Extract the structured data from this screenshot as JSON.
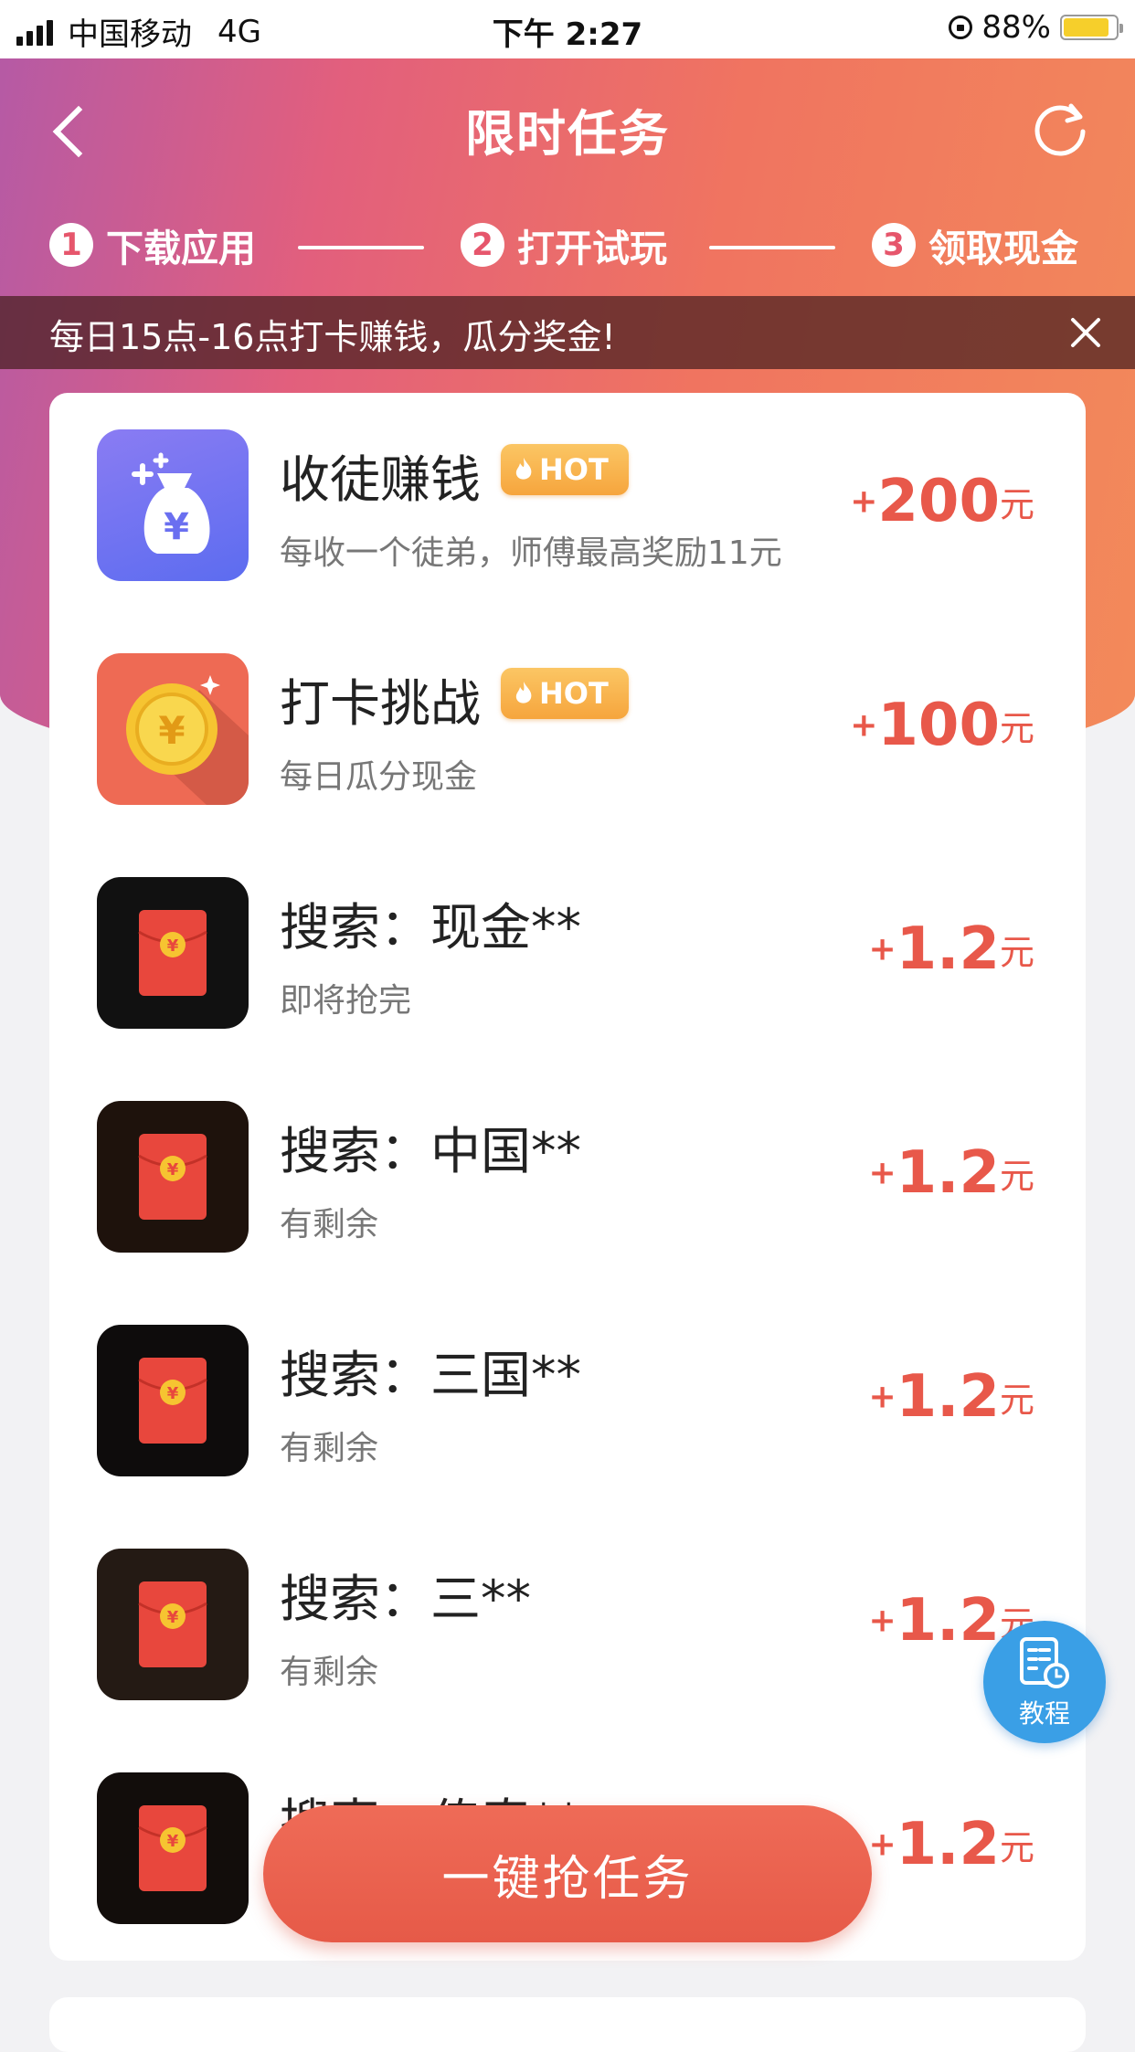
{
  "status_bar": {
    "carrier": "中国移动",
    "network": "4G",
    "time": "下午 2:27",
    "battery_percent": "88%",
    "battery_level": 0.88
  },
  "header": {
    "title": "限时任务",
    "back_icon": "chevron-left-icon",
    "refresh_icon": "refresh-icon"
  },
  "steps": [
    {
      "num": "1",
      "label": "下载应用"
    },
    {
      "num": "2",
      "label": "打开试玩"
    },
    {
      "num": "3",
      "label": "领取现金"
    }
  ],
  "notice": {
    "text": "每日15点-16点打卡赚钱，瓜分奖金!",
    "close_icon": "close-icon"
  },
  "tasks": [
    {
      "title": "收徒赚钱",
      "hot": "HOT",
      "subtitle": "每收一个徒弟，师傅最高奖励11元",
      "plus": "+",
      "amount": "200",
      "unit": "元",
      "icon": "money-bag-icon"
    },
    {
      "title": "打卡挑战",
      "hot": "HOT",
      "subtitle": "每日瓜分现金",
      "plus": "+",
      "amount": "100",
      "unit": "元",
      "icon": "gold-coin-icon"
    },
    {
      "title": "搜索：现金**",
      "subtitle": "即将抢完",
      "plus": "+",
      "amount": "1.2",
      "unit": "元",
      "icon": "red-envelope-icon"
    },
    {
      "title": "搜索：中国**",
      "subtitle": "有剩余",
      "plus": "+",
      "amount": "1.2",
      "unit": "元",
      "icon": "red-envelope-icon"
    },
    {
      "title": "搜索：三国**",
      "subtitle": "有剩余",
      "plus": "+",
      "amount": "1.2",
      "unit": "元",
      "icon": "red-envelope-icon"
    },
    {
      "title": "搜索：三**",
      "subtitle": "有剩余",
      "plus": "+",
      "amount": "1.2",
      "unit": "元",
      "icon": "red-envelope-icon"
    },
    {
      "title": "搜索：传奇**",
      "subtitle": "",
      "plus": "+",
      "amount": "1.2",
      "unit": "元",
      "icon": "red-envelope-icon"
    }
  ],
  "grab_button": "一键抢任务",
  "tutorial_button": "教程",
  "colors": {
    "accent_red": "#e8584a",
    "hot_badge": "#f6a53d",
    "tutorial_blue": "#3a9fe6"
  }
}
